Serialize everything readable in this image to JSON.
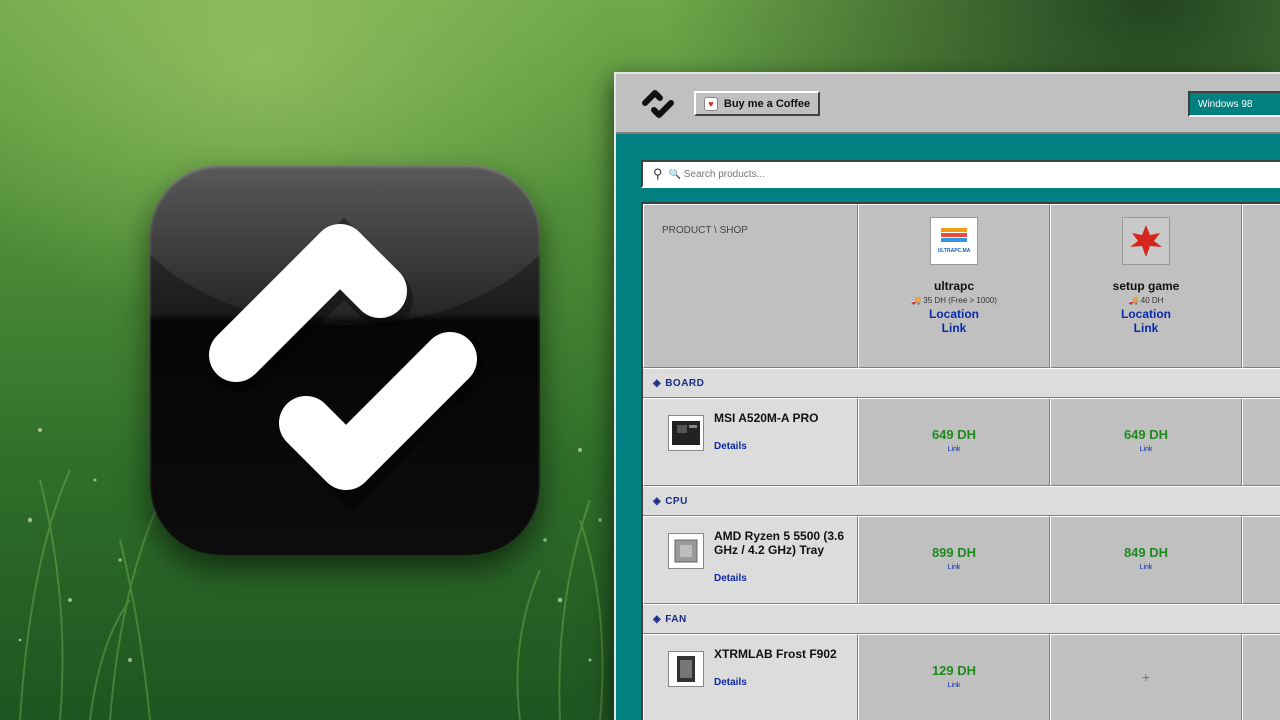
{
  "header": {
    "coffee_label": "Buy me a Coffee",
    "theme_value": "Windows 98"
  },
  "search": {
    "placeholder": "🔍 Search products..."
  },
  "table": {
    "corner_label": "PRODUCT \\ SHOP",
    "shops": [
      {
        "name": "ultrapc",
        "logo_text": "ULTRAPC.MA",
        "shipping": "35 DH (Free > 1000)",
        "location_label": "Location",
        "link_label": "Link"
      },
      {
        "name": "setup game",
        "shipping": "40 DH",
        "location_label": "Location",
        "link_label": "Link"
      }
    ],
    "categories": [
      {
        "name": "BOARD",
        "product": {
          "name": "MSI A520M-A PRO",
          "details_label": "Details",
          "prices": [
            {
              "value": "649 DH",
              "link_label": "Link"
            },
            {
              "value": "649 DH",
              "link_label": "Link"
            }
          ]
        }
      },
      {
        "name": "CPU",
        "product": {
          "name": "AMD Ryzen 5 5500 (3.6 GHz / 4.2 GHz) Tray",
          "details_label": "Details",
          "prices": [
            {
              "value": "899 DH",
              "link_label": "Link"
            },
            {
              "value": "849 DH",
              "link_label": "Link"
            }
          ]
        }
      },
      {
        "name": "FAN",
        "product": {
          "name": "XTRMLAB Frost F902",
          "details_label": "Details",
          "prices": [
            {
              "value": "129 DH",
              "link_label": "Link"
            },
            {
              "value": "+"
            }
          ]
        }
      }
    ]
  },
  "icons": [
    "app-logo-icon",
    "coffee-heart-icon",
    "search-icon",
    "layers-icon",
    "truck-icon"
  ],
  "colors": {
    "accent": "#008080",
    "window_gray": "#c0c0c0",
    "price_green": "#1e8a1e",
    "link_blue": "#0a2aa8"
  }
}
